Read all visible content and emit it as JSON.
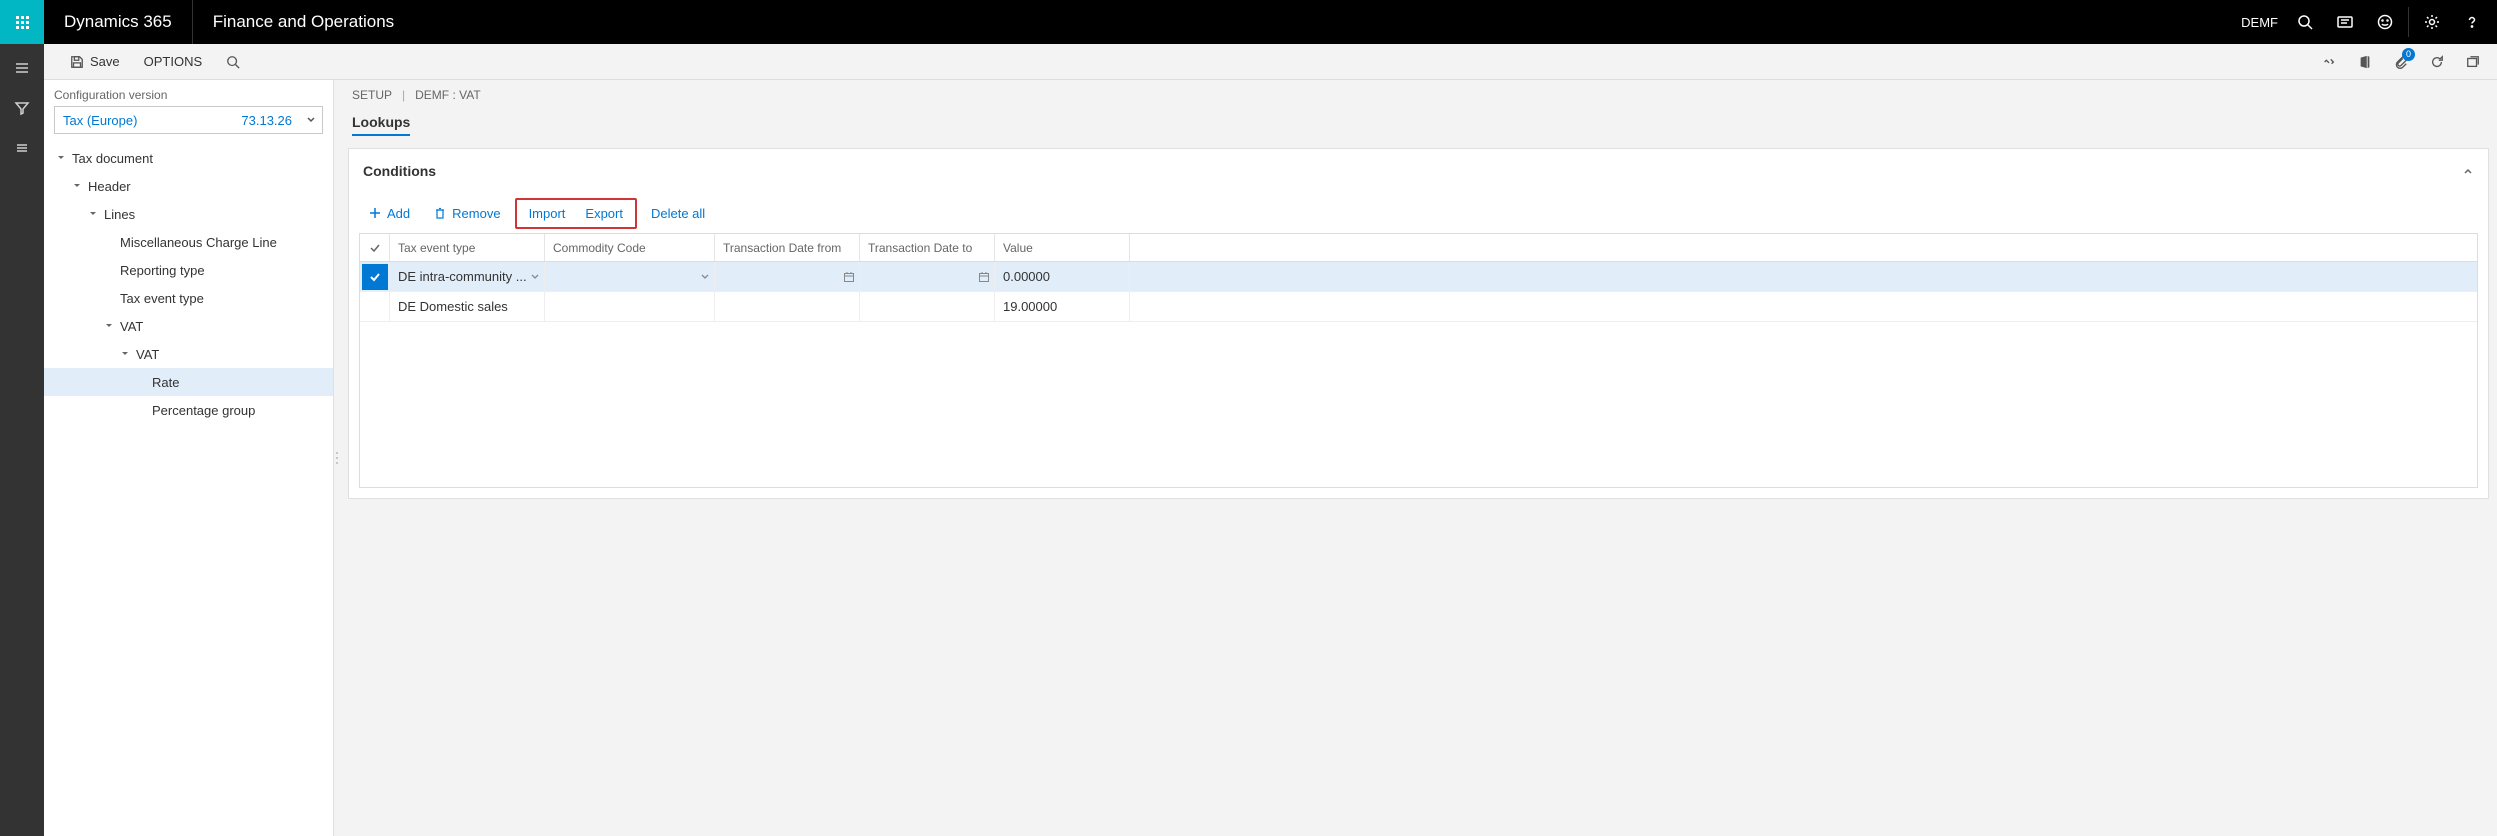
{
  "header": {
    "brand": "Dynamics 365",
    "module": "Finance and Operations",
    "company": "DEMF"
  },
  "actionbar": {
    "save": "Save",
    "options": "OPTIONS",
    "badge_count": "0"
  },
  "sidebar": {
    "config_label": "Configuration version",
    "config_name": "Tax (Europe)",
    "config_version": "73.13.26",
    "tree": [
      {
        "label": "Tax document",
        "level": 0,
        "caret": true
      },
      {
        "label": "Header",
        "level": 1,
        "caret": true
      },
      {
        "label": "Lines",
        "level": 2,
        "caret": true
      },
      {
        "label": "Miscellaneous Charge Line",
        "level": 3,
        "caret": false
      },
      {
        "label": "Reporting type",
        "level": 3,
        "caret": false
      },
      {
        "label": "Tax event type",
        "level": 3,
        "caret": false
      },
      {
        "label": "VAT",
        "level": 3,
        "caret": true
      },
      {
        "label": "VAT",
        "level": 4,
        "caret": true
      },
      {
        "label": "Rate",
        "level": 5,
        "caret": false,
        "selected": true
      },
      {
        "label": "Percentage group",
        "level": 5,
        "caret": false
      }
    ]
  },
  "content": {
    "breadcrumb_a": "SETUP",
    "breadcrumb_b": "DEMF : VAT",
    "tab": "Lookups",
    "panel_title": "Conditions",
    "toolbar": {
      "add": "Add",
      "remove": "Remove",
      "import": "Import",
      "export": "Export",
      "delete_all": "Delete all"
    },
    "grid": {
      "columns": {
        "event": "Tax event type",
        "commodity": "Commodity Code",
        "date_from": "Transaction Date from",
        "date_to": "Transaction Date to",
        "value": "Value"
      },
      "rows": [
        {
          "selected": true,
          "event": "DE intra-community ...",
          "commodity": "",
          "date_from": "",
          "date_to": "",
          "value": "0.00000"
        },
        {
          "selected": false,
          "event": "DE Domestic sales",
          "commodity": "",
          "date_from": "",
          "date_to": "",
          "value": "19.00000"
        }
      ]
    }
  }
}
